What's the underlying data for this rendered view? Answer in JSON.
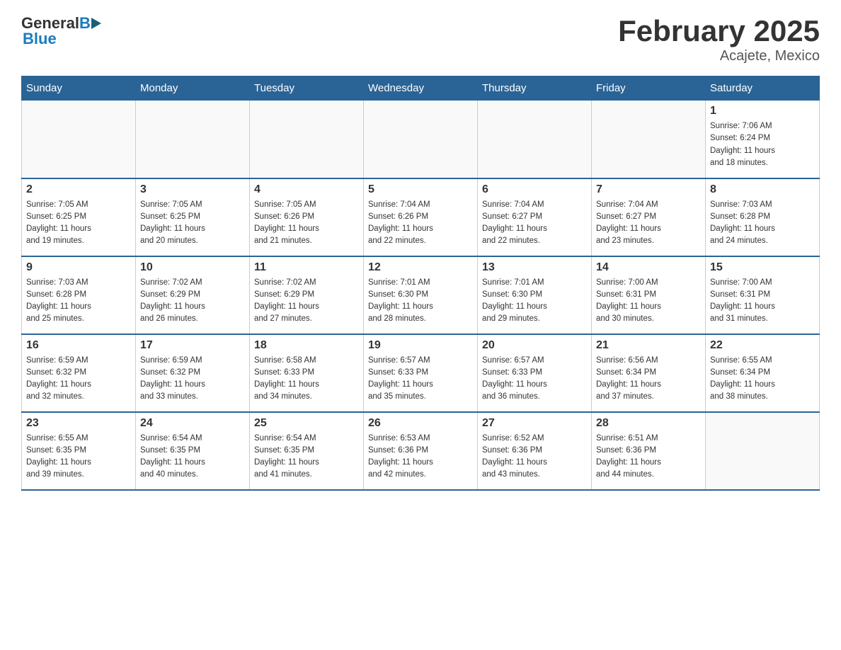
{
  "header": {
    "month_year": "February 2025",
    "location": "Acajete, Mexico",
    "logo_general": "General",
    "logo_blue": "Blue"
  },
  "weekdays": [
    "Sunday",
    "Monday",
    "Tuesday",
    "Wednesday",
    "Thursday",
    "Friday",
    "Saturday"
  ],
  "weeks": [
    [
      {
        "day": "",
        "info": ""
      },
      {
        "day": "",
        "info": ""
      },
      {
        "day": "",
        "info": ""
      },
      {
        "day": "",
        "info": ""
      },
      {
        "day": "",
        "info": ""
      },
      {
        "day": "",
        "info": ""
      },
      {
        "day": "1",
        "info": "Sunrise: 7:06 AM\nSunset: 6:24 PM\nDaylight: 11 hours\nand 18 minutes."
      }
    ],
    [
      {
        "day": "2",
        "info": "Sunrise: 7:05 AM\nSunset: 6:25 PM\nDaylight: 11 hours\nand 19 minutes."
      },
      {
        "day": "3",
        "info": "Sunrise: 7:05 AM\nSunset: 6:25 PM\nDaylight: 11 hours\nand 20 minutes."
      },
      {
        "day": "4",
        "info": "Sunrise: 7:05 AM\nSunset: 6:26 PM\nDaylight: 11 hours\nand 21 minutes."
      },
      {
        "day": "5",
        "info": "Sunrise: 7:04 AM\nSunset: 6:26 PM\nDaylight: 11 hours\nand 22 minutes."
      },
      {
        "day": "6",
        "info": "Sunrise: 7:04 AM\nSunset: 6:27 PM\nDaylight: 11 hours\nand 22 minutes."
      },
      {
        "day": "7",
        "info": "Sunrise: 7:04 AM\nSunset: 6:27 PM\nDaylight: 11 hours\nand 23 minutes."
      },
      {
        "day": "8",
        "info": "Sunrise: 7:03 AM\nSunset: 6:28 PM\nDaylight: 11 hours\nand 24 minutes."
      }
    ],
    [
      {
        "day": "9",
        "info": "Sunrise: 7:03 AM\nSunset: 6:28 PM\nDaylight: 11 hours\nand 25 minutes."
      },
      {
        "day": "10",
        "info": "Sunrise: 7:02 AM\nSunset: 6:29 PM\nDaylight: 11 hours\nand 26 minutes."
      },
      {
        "day": "11",
        "info": "Sunrise: 7:02 AM\nSunset: 6:29 PM\nDaylight: 11 hours\nand 27 minutes."
      },
      {
        "day": "12",
        "info": "Sunrise: 7:01 AM\nSunset: 6:30 PM\nDaylight: 11 hours\nand 28 minutes."
      },
      {
        "day": "13",
        "info": "Sunrise: 7:01 AM\nSunset: 6:30 PM\nDaylight: 11 hours\nand 29 minutes."
      },
      {
        "day": "14",
        "info": "Sunrise: 7:00 AM\nSunset: 6:31 PM\nDaylight: 11 hours\nand 30 minutes."
      },
      {
        "day": "15",
        "info": "Sunrise: 7:00 AM\nSunset: 6:31 PM\nDaylight: 11 hours\nand 31 minutes."
      }
    ],
    [
      {
        "day": "16",
        "info": "Sunrise: 6:59 AM\nSunset: 6:32 PM\nDaylight: 11 hours\nand 32 minutes."
      },
      {
        "day": "17",
        "info": "Sunrise: 6:59 AM\nSunset: 6:32 PM\nDaylight: 11 hours\nand 33 minutes."
      },
      {
        "day": "18",
        "info": "Sunrise: 6:58 AM\nSunset: 6:33 PM\nDaylight: 11 hours\nand 34 minutes."
      },
      {
        "day": "19",
        "info": "Sunrise: 6:57 AM\nSunset: 6:33 PM\nDaylight: 11 hours\nand 35 minutes."
      },
      {
        "day": "20",
        "info": "Sunrise: 6:57 AM\nSunset: 6:33 PM\nDaylight: 11 hours\nand 36 minutes."
      },
      {
        "day": "21",
        "info": "Sunrise: 6:56 AM\nSunset: 6:34 PM\nDaylight: 11 hours\nand 37 minutes."
      },
      {
        "day": "22",
        "info": "Sunrise: 6:55 AM\nSunset: 6:34 PM\nDaylight: 11 hours\nand 38 minutes."
      }
    ],
    [
      {
        "day": "23",
        "info": "Sunrise: 6:55 AM\nSunset: 6:35 PM\nDaylight: 11 hours\nand 39 minutes."
      },
      {
        "day": "24",
        "info": "Sunrise: 6:54 AM\nSunset: 6:35 PM\nDaylight: 11 hours\nand 40 minutes."
      },
      {
        "day": "25",
        "info": "Sunrise: 6:54 AM\nSunset: 6:35 PM\nDaylight: 11 hours\nand 41 minutes."
      },
      {
        "day": "26",
        "info": "Sunrise: 6:53 AM\nSunset: 6:36 PM\nDaylight: 11 hours\nand 42 minutes."
      },
      {
        "day": "27",
        "info": "Sunrise: 6:52 AM\nSunset: 6:36 PM\nDaylight: 11 hours\nand 43 minutes."
      },
      {
        "day": "28",
        "info": "Sunrise: 6:51 AM\nSunset: 6:36 PM\nDaylight: 11 hours\nand 44 minutes."
      },
      {
        "day": "",
        "info": ""
      }
    ]
  ]
}
